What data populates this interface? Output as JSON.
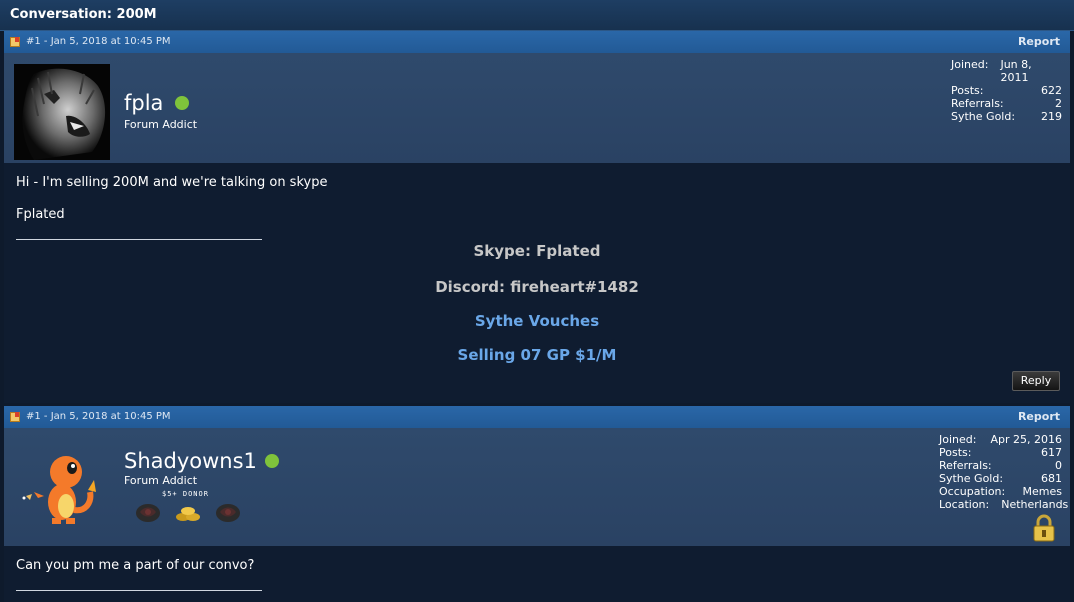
{
  "conversation": {
    "title": "Conversation: 200M"
  },
  "posts": [
    {
      "meta": "#1 - Jan 5, 2018 at 10:45 PM",
      "report_label": "Report",
      "username": "fpla",
      "user_title": "Forum Addict",
      "stats": [
        {
          "label": "Joined:",
          "value": "Jun 8, 2011"
        },
        {
          "label": "Posts:",
          "value": "622"
        },
        {
          "label": "Referrals:",
          "value": "2"
        },
        {
          "label": "Sythe Gold:",
          "value": "219"
        }
      ],
      "body": [
        "Hi - I'm selling 200M and we're talking on skype",
        "Fplated"
      ],
      "signature": {
        "skype": "Skype: Fplated",
        "discord": "Discord: fireheart#1482",
        "vouches_link": "Sythe Vouches",
        "selling_link": "Selling 07 GP $1/M"
      },
      "reply_label": "Reply"
    },
    {
      "meta": "#1 - Jan 5, 2018 at 10:45 PM",
      "report_label": "Report",
      "username": "Shadyowns1",
      "user_title": "Forum Addict",
      "donor_badge": "$5+ DONOR",
      "stats": [
        {
          "label": "Joined:",
          "value": "Apr 25, 2016"
        },
        {
          "label": "Posts:",
          "value": "617"
        },
        {
          "label": "Referrals:",
          "value": "0"
        },
        {
          "label": "Sythe Gold:",
          "value": "681"
        },
        {
          "label": "Occupation:",
          "value": "Memes"
        },
        {
          "label": "Location:",
          "value": "Netherlands"
        }
      ],
      "body": [
        "Can you pm me a part of our convo?"
      ]
    }
  ],
  "icons": {
    "online": "online-status-icon",
    "lock": "padlock-icon",
    "post": "post-icon"
  },
  "colors": {
    "online": "#7fc33b",
    "link": "#6aa7e8",
    "bar": "#2a67a8"
  }
}
